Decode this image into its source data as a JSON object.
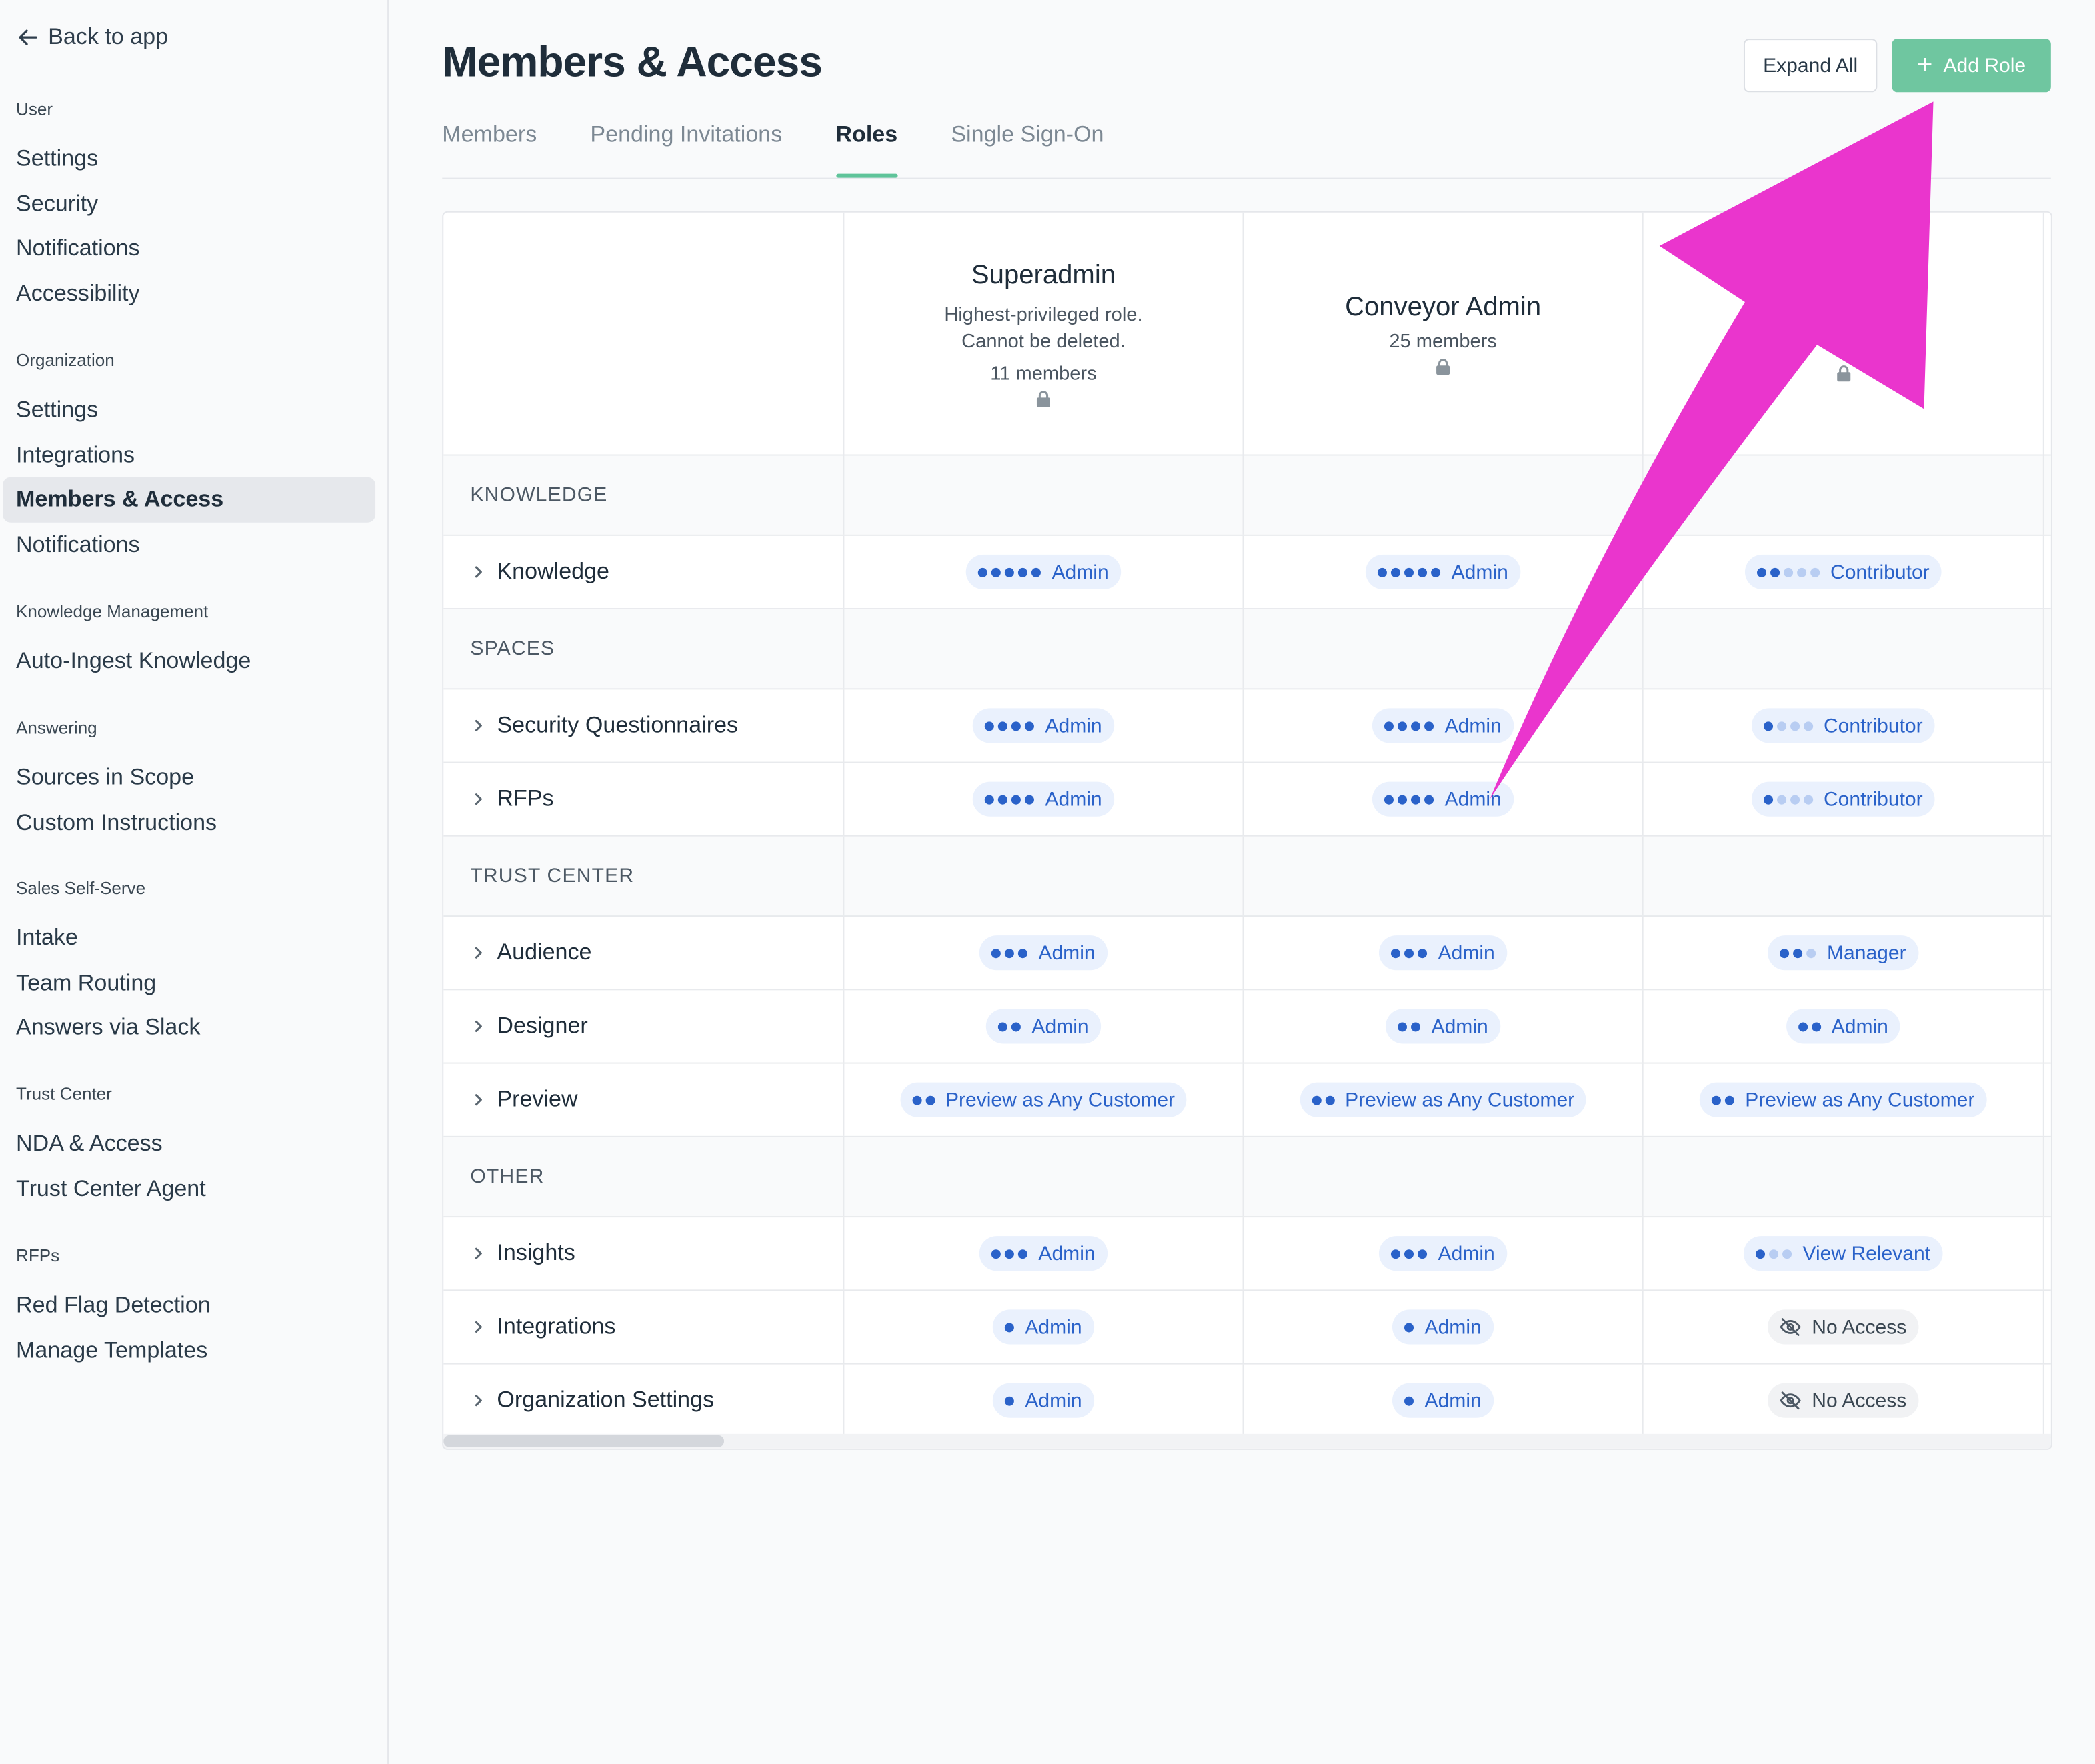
{
  "sidebar": {
    "back_label": "Back to app",
    "sections": [
      {
        "heading": "User",
        "items": [
          "Settings",
          "Security",
          "Notifications",
          "Accessibility"
        ]
      },
      {
        "heading": "Organization",
        "items": [
          "Settings",
          "Integrations",
          "Members & Access",
          "Notifications"
        ]
      },
      {
        "heading": "Knowledge Management",
        "items": [
          "Auto-Ingest Knowledge"
        ]
      },
      {
        "heading": "Answering",
        "items": [
          "Sources in Scope",
          "Custom Instructions"
        ]
      },
      {
        "heading": "Sales Self-Serve",
        "items": [
          "Intake",
          "Team Routing",
          "Answers via Slack"
        ]
      },
      {
        "heading": "Trust Center",
        "items": [
          "NDA & Access",
          "Trust Center Agent"
        ]
      },
      {
        "heading": "RFPs",
        "items": [
          "Red Flag Detection",
          "Manage Templates"
        ]
      }
    ],
    "active_item": "Members & Access"
  },
  "header": {
    "title": "Members & Access",
    "expand_all_label": "Expand All",
    "add_role_label": "Add Role"
  },
  "tabs": [
    "Members",
    "Pending Invitations",
    "Roles",
    "Single Sign-On"
  ],
  "active_tab": "Roles",
  "roles": [
    {
      "name": "Superadmin",
      "description_line1": "Highest-privileged role.",
      "description_line2": "Cannot be deleted.",
      "members": "11 members"
    },
    {
      "name": "Conveyor Admin",
      "members": "25 members"
    },
    {
      "name": "",
      "members": ""
    }
  ],
  "sections": [
    {
      "label": "KNOWLEDGE",
      "rows": [
        {
          "label": "Knowledge",
          "cells": [
            {
              "text": "Admin",
              "level": 5,
              "max": 5
            },
            {
              "text": "Admin",
              "level": 5,
              "max": 5
            },
            {
              "text": "Contributor",
              "level": 2,
              "max": 5
            }
          ]
        }
      ]
    },
    {
      "label": "SPACES",
      "rows": [
        {
          "label": "Security Questionnaires",
          "cells": [
            {
              "text": "Admin",
              "level": 4,
              "max": 4
            },
            {
              "text": "Admin",
              "level": 4,
              "max": 4
            },
            {
              "text": "Contributor",
              "level": 1,
              "max": 4
            }
          ]
        },
        {
          "label": "RFPs",
          "cells": [
            {
              "text": "Admin",
              "level": 4,
              "max": 4
            },
            {
              "text": "Admin",
              "level": 4,
              "max": 4
            },
            {
              "text": "Contributor",
              "level": 1,
              "max": 4
            }
          ]
        }
      ]
    },
    {
      "label": "TRUST CENTER",
      "rows": [
        {
          "label": "Audience",
          "cells": [
            {
              "text": "Admin",
              "level": 3,
              "max": 3
            },
            {
              "text": "Admin",
              "level": 3,
              "max": 3
            },
            {
              "text": "Manager",
              "level": 2,
              "max": 3
            }
          ]
        },
        {
          "label": "Designer",
          "cells": [
            {
              "text": "Admin",
              "level": 2,
              "max": 2
            },
            {
              "text": "Admin",
              "level": 2,
              "max": 2
            },
            {
              "text": "Admin",
              "level": 2,
              "max": 2
            }
          ]
        },
        {
          "label": "Preview",
          "cells": [
            {
              "text": "Preview as Any Customer",
              "level": 2,
              "max": 2
            },
            {
              "text": "Preview as Any Customer",
              "level": 2,
              "max": 2
            },
            {
              "text": "Preview as Any Customer",
              "level": 2,
              "max": 2
            }
          ]
        }
      ]
    },
    {
      "label": "OTHER",
      "rows": [
        {
          "label": "Insights",
          "cells": [
            {
              "text": "Admin",
              "level": 3,
              "max": 3
            },
            {
              "text": "Admin",
              "level": 3,
              "max": 3
            },
            {
              "text": "View Relevant",
              "level": 1,
              "max": 3
            }
          ]
        },
        {
          "label": "Integrations",
          "cells": [
            {
              "text": "Admin",
              "level": 1,
              "max": 1
            },
            {
              "text": "Admin",
              "level": 1,
              "max": 1
            },
            {
              "text": "No Access",
              "level": 0,
              "max": 0
            }
          ]
        },
        {
          "label": "Organization Settings",
          "cells": [
            {
              "text": "Admin",
              "level": 1,
              "max": 1
            },
            {
              "text": "Admin",
              "level": 1,
              "max": 1
            },
            {
              "text": "No Access",
              "level": 0,
              "max": 0
            }
          ]
        }
      ]
    }
  ],
  "colors": {
    "accent_green": "#6fc6a0",
    "pill_blue": "#2a62c9",
    "annotation_arrow": "#ea35cd"
  },
  "icons": {
    "back": "arrow-left-icon",
    "add": "plus-icon",
    "lock": "lock-icon",
    "expand_row": "chevron-right-icon",
    "no_access": "eye-off-icon",
    "annotation": "arrow-annotation"
  }
}
